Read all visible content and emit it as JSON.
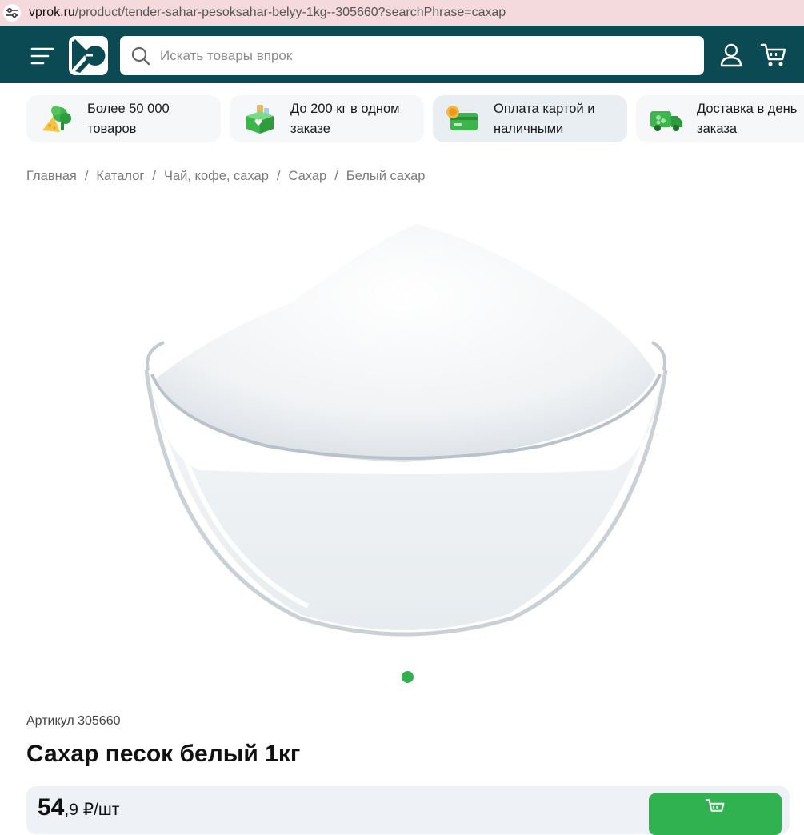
{
  "browser": {
    "url_host": "vprok.ru",
    "url_rest": "/product/tender-sahar-pesoksahar-belyy-1kg--305660?searchPhrase=сахар"
  },
  "header": {
    "search_placeholder": "Искать товары впрок",
    "logo_icon": "vprok-logo-icon",
    "menu_icon": "hamburger-menu-icon",
    "user_icon": "user-icon",
    "cart_icon": "cart-icon"
  },
  "benefits": [
    {
      "line1": "Более 50 000",
      "line2": "товаров",
      "icon": "produce-icon"
    },
    {
      "line1": "До 200 кг в одном",
      "line2": "заказе",
      "icon": "box-icon"
    },
    {
      "line1": "Оплата картой и",
      "line2": "наличными",
      "icon": "payment-card-icon"
    },
    {
      "line1": "Доставка в день",
      "line2": "заказа",
      "icon": "delivery-truck-icon"
    }
  ],
  "breadcrumb": [
    "Главная",
    "Каталог",
    "Чай, кофе, сахар",
    "Сахар",
    "Белый сахар"
  ],
  "product": {
    "article": "Артикул 305660",
    "title": "Сахар песок белый 1кг",
    "price_main": "54",
    "price_cents": ",9",
    "price_unit": " ₽/шт",
    "gallery_count": 1,
    "gallery_active": 1
  },
  "colors": {
    "header_bg": "#0b4a52",
    "accent_green": "#2fb24f",
    "card_bg": "#f5f7f8",
    "url_bar_bg": "#f4d9dd"
  }
}
